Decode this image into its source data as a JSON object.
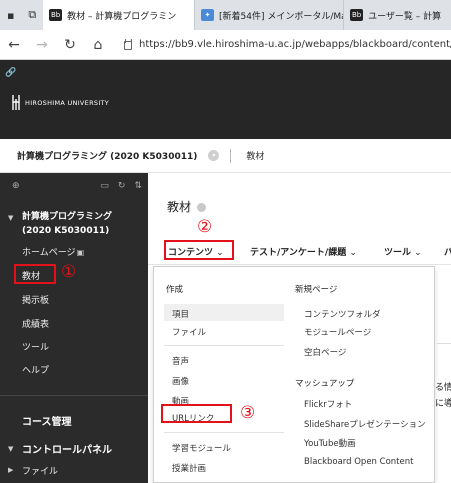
{
  "browser": {
    "tabs": [
      {
        "label": "教材 – 計算機プログラミン",
        "active": true
      },
      {
        "label": "[新着54件] メインポータル/Mai",
        "active": false
      },
      {
        "label": "ユーザー覧 – 計算",
        "active": false
      }
    ],
    "url": "https://bb9.vle.hiroshima-u.ac.jp/webapps/blackboard/content/listC"
  },
  "header": {
    "logo_text": "HIROSHIMA UNIVERSITY"
  },
  "breadcrumb": {
    "course": "計算機プログラミング (2020 K5030011)",
    "page": "教材"
  },
  "sidebar": {
    "course_line1": "計算機プログラミング",
    "course_line2": "(2020 K5030011)",
    "items": [
      {
        "label": "ホームページ",
        "suffix": "▣"
      },
      {
        "label": "教材"
      },
      {
        "label": "掲示板"
      },
      {
        "label": "成績表"
      },
      {
        "label": "ツール"
      },
      {
        "label": "ヘルプ"
      }
    ],
    "sections": [
      {
        "label": "コース管理"
      },
      {
        "label": "コントロールパネル"
      }
    ],
    "sub_items": [
      {
        "label": "ファイル"
      }
    ]
  },
  "main": {
    "title": "教材",
    "menu": [
      {
        "label": "コンテンツ"
      },
      {
        "label": "テスト/アンケート/課題"
      },
      {
        "label": "ツール"
      },
      {
        "label": "パ"
      }
    ]
  },
  "dropdown": {
    "left_heading": "作成",
    "left_groups": [
      [
        "項目",
        "ファイル"
      ],
      [
        "音声",
        "画像",
        "動画",
        "URLリンク"
      ],
      [
        "学習モジュール",
        "授業計画"
      ]
    ],
    "right_heading_1": "新規ページ",
    "right_group_1": [
      "コンテンツフォルダ",
      "モジュールページ",
      "空白ページ"
    ],
    "right_heading_2": "マッシュアップ",
    "right_group_2": [
      "Flickrフォト",
      "SlideShareプレゼンテーション",
      "YouTube動画",
      "Blackboard Open Content"
    ]
  },
  "background_fragments": [
    "る情",
    "に導入"
  ],
  "annotations": [
    "①",
    "②",
    "③"
  ],
  "colors": {
    "annotation_red": "#e3111a",
    "header_bg": "#262626",
    "sidebar_bg": "#2b2b2b"
  }
}
